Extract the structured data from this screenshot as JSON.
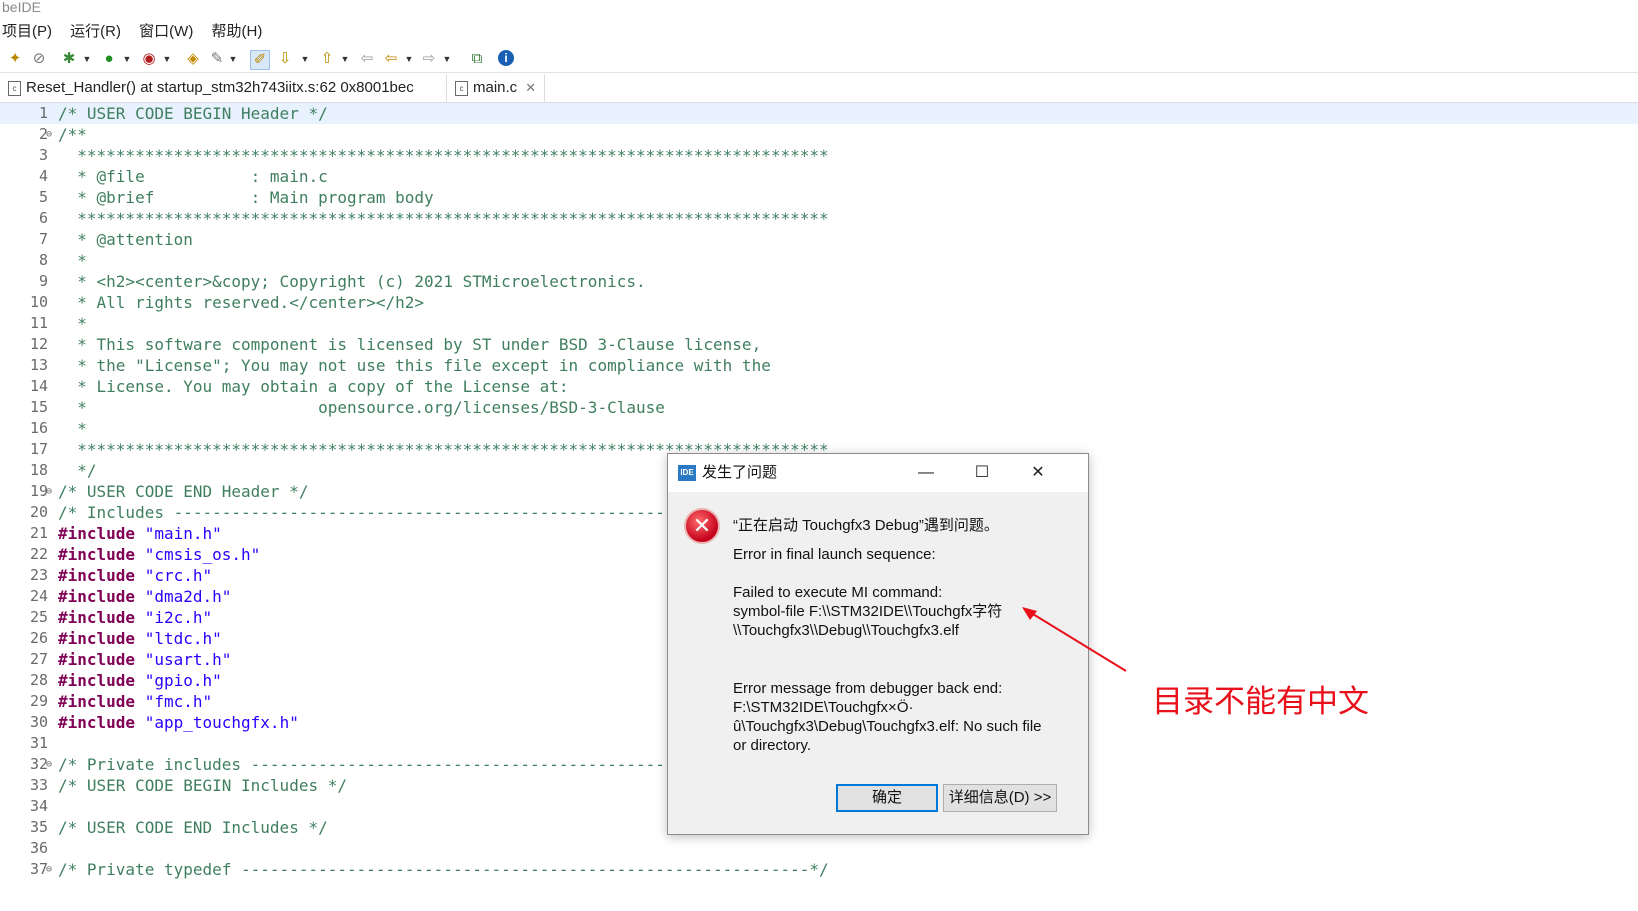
{
  "window": {
    "title": "beIDE"
  },
  "menu": [
    "项目(P)",
    "运行(R)",
    "窗口(W)",
    "帮助(H)"
  ],
  "toolbar_icons": [
    "debug-config-icon",
    "skip-breakpoints-icon",
    "debug-icon",
    "run-icon",
    "external-tools-icon",
    "open-type-icon",
    "build-icon",
    "mark-occurrences-icon",
    "next-annotation-icon",
    "prev-annotation-icon",
    "back-icon",
    "forward-icon",
    "open-perspective-icon",
    "info-icon"
  ],
  "tabs": [
    {
      "label": "Reset_Handler() at startup_stm32h743iitx.s:62 0x8001bec",
      "icon": "source-file-icon"
    },
    {
      "label": "main.c",
      "icon": "c-file-icon",
      "close": "✕"
    }
  ],
  "editor_lines": [
    {
      "n": "1",
      "fold": "",
      "cur": true,
      "parts": [
        {
          "t": "/* USER CODE BEGIN Header */",
          "c": "cm"
        }
      ]
    },
    {
      "n": "2",
      "fold": "⊖",
      "parts": [
        {
          "t": "/**",
          "c": "cm"
        }
      ]
    },
    {
      "n": "3",
      "fold": "",
      "parts": [
        {
          "t": "  ******************************************************************************",
          "c": "cm"
        }
      ]
    },
    {
      "n": "4",
      "fold": "",
      "parts": [
        {
          "t": "  * @file           : main.c",
          "c": "cm"
        }
      ]
    },
    {
      "n": "5",
      "fold": "",
      "parts": [
        {
          "t": "  * @brief          : Main program body",
          "c": "cm"
        }
      ]
    },
    {
      "n": "6",
      "fold": "",
      "parts": [
        {
          "t": "  ******************************************************************************",
          "c": "cm"
        }
      ]
    },
    {
      "n": "7",
      "fold": "",
      "parts": [
        {
          "t": "  * @attention",
          "c": "cm"
        }
      ]
    },
    {
      "n": "8",
      "fold": "",
      "parts": [
        {
          "t": "  *",
          "c": "cm"
        }
      ]
    },
    {
      "n": "9",
      "fold": "",
      "parts": [
        {
          "t": "  * <h2><center>&copy; Copyright (c) 2021 STMicroelectronics.",
          "c": "cm"
        }
      ]
    },
    {
      "n": "10",
      "fold": "",
      "parts": [
        {
          "t": "  * All rights reserved.</center></h2>",
          "c": "cm"
        }
      ]
    },
    {
      "n": "11",
      "fold": "",
      "parts": [
        {
          "t": "  *",
          "c": "cm"
        }
      ]
    },
    {
      "n": "12",
      "fold": "",
      "parts": [
        {
          "t": "  * This software component is licensed by ST under BSD 3-Clause license,",
          "c": "cm"
        }
      ]
    },
    {
      "n": "13",
      "fold": "",
      "parts": [
        {
          "t": "  * the \"License\"; You may not use this file except in compliance with the",
          "c": "cm"
        }
      ]
    },
    {
      "n": "14",
      "fold": "",
      "parts": [
        {
          "t": "  * License. You may obtain a copy of the License at:",
          "c": "cm"
        }
      ]
    },
    {
      "n": "15",
      "fold": "",
      "parts": [
        {
          "t": "  *                        opensource.org/licenses/BSD-3-Clause",
          "c": "cm"
        }
      ]
    },
    {
      "n": "16",
      "fold": "",
      "parts": [
        {
          "t": "  *",
          "c": "cm"
        }
      ]
    },
    {
      "n": "17",
      "fold": "",
      "parts": [
        {
          "t": "  ******************************************************************************",
          "c": "cm"
        }
      ]
    },
    {
      "n": "18",
      "fold": "",
      "parts": [
        {
          "t": "  */",
          "c": "cm"
        }
      ]
    },
    {
      "n": "19",
      "fold": "⊖",
      "parts": [
        {
          "t": "/* USER CODE END Header */",
          "c": "cm"
        }
      ]
    },
    {
      "n": "20",
      "fold": "",
      "parts": [
        {
          "t": "/* Includes ------------------------------------------------------------------*/",
          "c": "cm"
        }
      ]
    },
    {
      "n": "21",
      "fold": "",
      "parts": [
        {
          "t": "#include",
          "c": "kw"
        },
        {
          "t": " ",
          "c": ""
        },
        {
          "t": "\"main.h\"",
          "c": "str"
        }
      ]
    },
    {
      "n": "22",
      "fold": "",
      "parts": [
        {
          "t": "#include",
          "c": "kw"
        },
        {
          "t": " ",
          "c": ""
        },
        {
          "t": "\"cmsis_os.h\"",
          "c": "str"
        }
      ]
    },
    {
      "n": "23",
      "fold": "",
      "parts": [
        {
          "t": "#include",
          "c": "kw"
        },
        {
          "t": " ",
          "c": ""
        },
        {
          "t": "\"crc.h\"",
          "c": "str"
        }
      ]
    },
    {
      "n": "24",
      "fold": "",
      "parts": [
        {
          "t": "#include",
          "c": "kw"
        },
        {
          "t": " ",
          "c": ""
        },
        {
          "t": "\"dma2d.h\"",
          "c": "str"
        }
      ]
    },
    {
      "n": "25",
      "fold": "",
      "parts": [
        {
          "t": "#include",
          "c": "kw"
        },
        {
          "t": " ",
          "c": ""
        },
        {
          "t": "\"i2c.h\"",
          "c": "str"
        }
      ]
    },
    {
      "n": "26",
      "fold": "",
      "parts": [
        {
          "t": "#include",
          "c": "kw"
        },
        {
          "t": " ",
          "c": ""
        },
        {
          "t": "\"ltdc.h\"",
          "c": "str"
        }
      ]
    },
    {
      "n": "27",
      "fold": "",
      "parts": [
        {
          "t": "#include",
          "c": "kw"
        },
        {
          "t": " ",
          "c": ""
        },
        {
          "t": "\"usart.h\"",
          "c": "str"
        }
      ]
    },
    {
      "n": "28",
      "fold": "",
      "parts": [
        {
          "t": "#include",
          "c": "kw"
        },
        {
          "t": " ",
          "c": ""
        },
        {
          "t": "\"gpio.h\"",
          "c": "str"
        }
      ]
    },
    {
      "n": "29",
      "fold": "",
      "parts": [
        {
          "t": "#include",
          "c": "kw"
        },
        {
          "t": " ",
          "c": ""
        },
        {
          "t": "\"fmc.h\"",
          "c": "str"
        }
      ]
    },
    {
      "n": "30",
      "fold": "",
      "parts": [
        {
          "t": "#include",
          "c": "kw"
        },
        {
          "t": " ",
          "c": ""
        },
        {
          "t": "\"app_touchgfx.h\"",
          "c": "str"
        }
      ]
    },
    {
      "n": "31",
      "fold": "",
      "parts": []
    },
    {
      "n": "32",
      "fold": "⊖",
      "parts": [
        {
          "t": "/* Private includes ----------------------------------------------------------*/",
          "c": "cm"
        }
      ]
    },
    {
      "n": "33",
      "fold": "",
      "parts": [
        {
          "t": "/* USER CODE BEGIN Includes */",
          "c": "cm"
        }
      ]
    },
    {
      "n": "34",
      "fold": "",
      "parts": []
    },
    {
      "n": "35",
      "fold": "",
      "parts": [
        {
          "t": "/* USER CODE END Includes */",
          "c": "cm"
        }
      ]
    },
    {
      "n": "36",
      "fold": "",
      "parts": []
    },
    {
      "n": "37",
      "fold": "⊖",
      "parts": [
        {
          "t": "/* Private typedef -----------------------------------------------------------*/",
          "c": "cm"
        }
      ]
    }
  ],
  "dialog": {
    "icon_text": "IDE",
    "title": "发生了问题",
    "controls": {
      "minimize": "—",
      "maximize": "☐",
      "close": "✕"
    },
    "heading": "“正在启动 Touchgfx3 Debug”遇到问题。",
    "line1": "Error in final launch sequence:",
    "line2": "Failed to execute MI command:",
    "line3": "symbol-file F:\\\\STM32IDE\\\\Touchgfx字符",
    "line4": "\\\\Touchgfx3\\\\Debug\\\\Touchgfx3.elf",
    "line5": "Error message from debugger back end:",
    "line6": "F:\\STM32IDE\\Touchgfx×Ö·",
    "line7": "û\\Touchgfx3\\Debug\\Touchgfx3.elf: No such file",
    "line8": "or directory.",
    "ok_label": "确定",
    "details_label": "详细信息(D) >>"
  },
  "annotation": {
    "text": "目录不能有中文",
    "color": "#e8101a"
  }
}
